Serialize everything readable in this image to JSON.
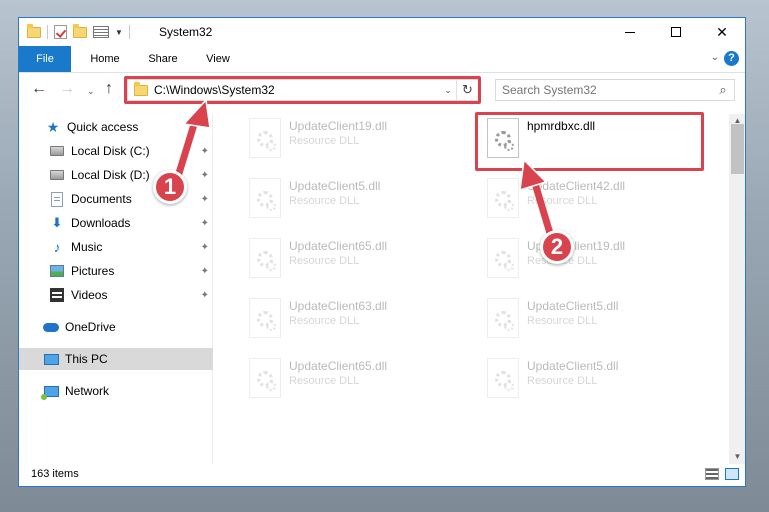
{
  "window": {
    "title": "System32",
    "min_glyph": "",
    "close_glyph": "✕"
  },
  "ribbon": {
    "tabs": [
      "File",
      "Home",
      "Share",
      "View"
    ],
    "help_glyph": "?",
    "expand_glyph": "⌄"
  },
  "nav": {
    "back_glyph": "←",
    "forward_glyph": "→",
    "recent_glyph": "⌄",
    "up_glyph": "↑",
    "address": "C:\\Windows\\System32",
    "address_drop_glyph": "⌄",
    "refresh_glyph": "↻",
    "search_placeholder": "Search System32",
    "search_glyph": "⌕"
  },
  "sidebar": {
    "items": [
      {
        "label": "Quick access",
        "icon": "star-icon"
      },
      {
        "label": "Local Disk (C:)",
        "icon": "disk-icon",
        "pinned": true
      },
      {
        "label": "Local Disk (D:)",
        "icon": "disk-icon",
        "pinned": true
      },
      {
        "label": "Documents",
        "icon": "documents-icon",
        "pinned": true
      },
      {
        "label": "Downloads",
        "icon": "download-icon",
        "pinned": true
      },
      {
        "label": "Music",
        "icon": "music-icon",
        "pinned": true
      },
      {
        "label": "Pictures",
        "icon": "pictures-icon",
        "pinned": true
      },
      {
        "label": "Videos",
        "icon": "video-icon",
        "pinned": true
      },
      {
        "label": "OneDrive",
        "icon": "cloud-icon"
      },
      {
        "label": "This PC",
        "icon": "computer-icon",
        "selected": true
      },
      {
        "label": "Network",
        "icon": "network-icon"
      }
    ],
    "pin_glyph": "📌"
  },
  "files": [
    {
      "name": "UpdateClient19.dll",
      "type": "Resource DLL",
      "highlighted": false
    },
    {
      "name": "hpmrdbxc.dll",
      "type": "",
      "highlighted": true
    },
    {
      "name": "UpdateClient5.dll",
      "type": "Resource DLL",
      "highlighted": false
    },
    {
      "name": "UpdateClient42.dll",
      "type": "Resource DLL",
      "highlighted": false
    },
    {
      "name": "UpdateClient65.dll",
      "type": "Resource DLL",
      "highlighted": false
    },
    {
      "name": "UpdateClient19.dll",
      "type": "Resource DLL",
      "highlighted": false
    },
    {
      "name": "UpdateClient63.dll",
      "type": "Resource DLL",
      "highlighted": false
    },
    {
      "name": "UpdateClient5.dll",
      "type": "Resource DLL",
      "highlighted": false
    },
    {
      "name": "UpdateClient65.dll",
      "type": "Resource DLL",
      "highlighted": false
    },
    {
      "name": "UpdateClient5.dll",
      "type": "Resource DLL",
      "highlighted": false
    }
  ],
  "status": {
    "item_count": "163 items"
  },
  "annotations": {
    "step1": "1",
    "step2": "2",
    "color": "#d9434e"
  },
  "colors": {
    "accent": "#1979ca",
    "highlight": "#d9434e"
  }
}
